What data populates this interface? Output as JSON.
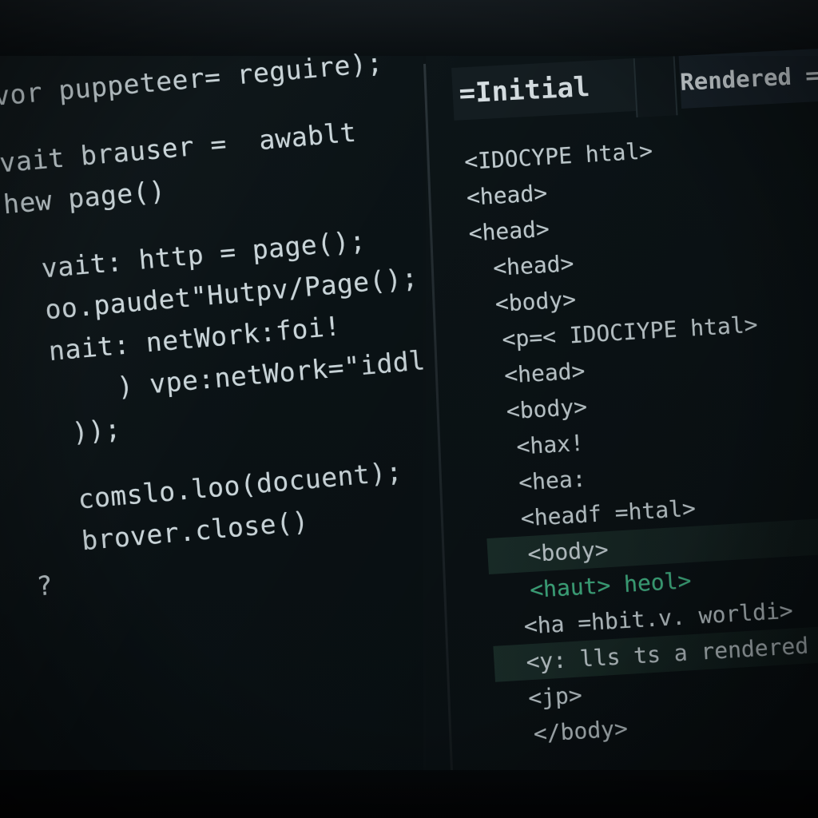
{
  "editor": {
    "code_lines": [
      "vor puppeteer= reguire);",
      "",
      "vait brauser =  awablt",
      "hew page()",
      "",
      "  vait: http = page();",
      "  oo.paudet\"Hutpv/Page();",
      "  nait: netWork:foi!",
      "      ) vpe:netWork=\"iddl\";",
      "   ));",
      "",
      "   comslo.loo(docuent);",
      "   brover.close()",
      "?"
    ]
  },
  "preview": {
    "tab_initial_label": "=Initial",
    "tab_rendered_label": "Rendered =",
    "html_lines": [
      "<IDOCYPE htal>",
      "<head>",
      "<head>",
      "<head>",
      "<body>",
      "<p=< IDOCIYPE htal>",
      "<head>",
      "<body>",
      "<hax!",
      "<hea:",
      "<headf =htal>",
      "<body>",
      "<haut> heol>",
      "<ha =hbit.v. worldi>",
      "<y: lls ts a rendered page",
      "<jp>",
      "</body>"
    ]
  }
}
